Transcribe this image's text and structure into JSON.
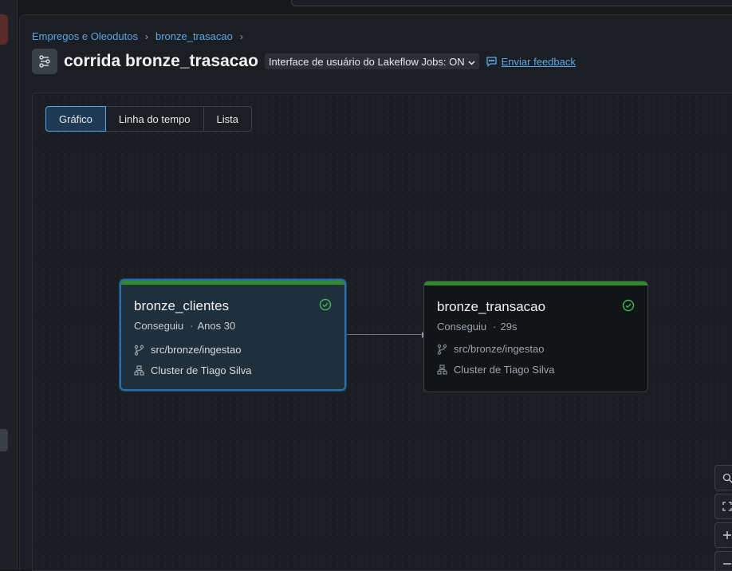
{
  "breadcrumb": {
    "items": [
      "Empregos e Oleodutos",
      "bronze_trasacao"
    ]
  },
  "header": {
    "title": "corrida bronze_trasacao",
    "ui_toggle": "Interface de usuário do Lakeflow Jobs: ON",
    "feedback": "Enviar feedback"
  },
  "view_tabs": [
    "Gráfico",
    "Linha do tempo",
    "Lista"
  ],
  "active_tab": "Gráfico",
  "tasks": [
    {
      "name": "bronze_clientes",
      "status": "Conseguiu",
      "duration": "Anos 30",
      "source": "src/bronze/ingestao",
      "cluster": "Cluster de Tiago Silva"
    },
    {
      "name": "bronze_transacao",
      "status": "Conseguiu",
      "duration": "29s",
      "source": "src/bronze/ingestao",
      "cluster": "Cluster de Tiago Silva"
    }
  ],
  "colors": {
    "accent": "#5ba7e6",
    "success": "#2f8a2a",
    "success_icon": "#3fb950"
  },
  "icons": [
    "search-icon",
    "fullscreen-icon",
    "zoom-in-icon",
    "zoom-out-icon",
    "check-circle-icon",
    "git-branch-icon",
    "cluster-icon",
    "workflow-icon",
    "chat-icon",
    "chevron-down-icon"
  ]
}
